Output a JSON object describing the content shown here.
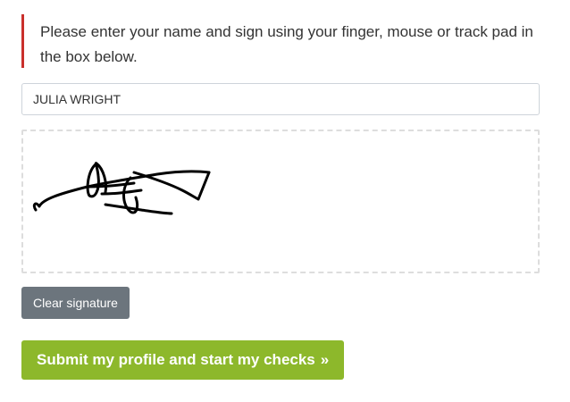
{
  "notice": {
    "text": "Please enter your name and sign using your finger, mouse or track pad in the box below."
  },
  "name_field": {
    "value": "JULIA WRIGHT",
    "placeholder": ""
  },
  "signature": {
    "has_signature": true
  },
  "buttons": {
    "clear_label": "Clear signature",
    "submit_label": "Submit my profile and start my checks",
    "submit_icon": "double-chevron-right-icon",
    "submit_icon_glyph": "»"
  },
  "colors": {
    "notice_border": "#c9302c",
    "clear_button": "#6c757d",
    "submit_button": "#8db82b"
  }
}
